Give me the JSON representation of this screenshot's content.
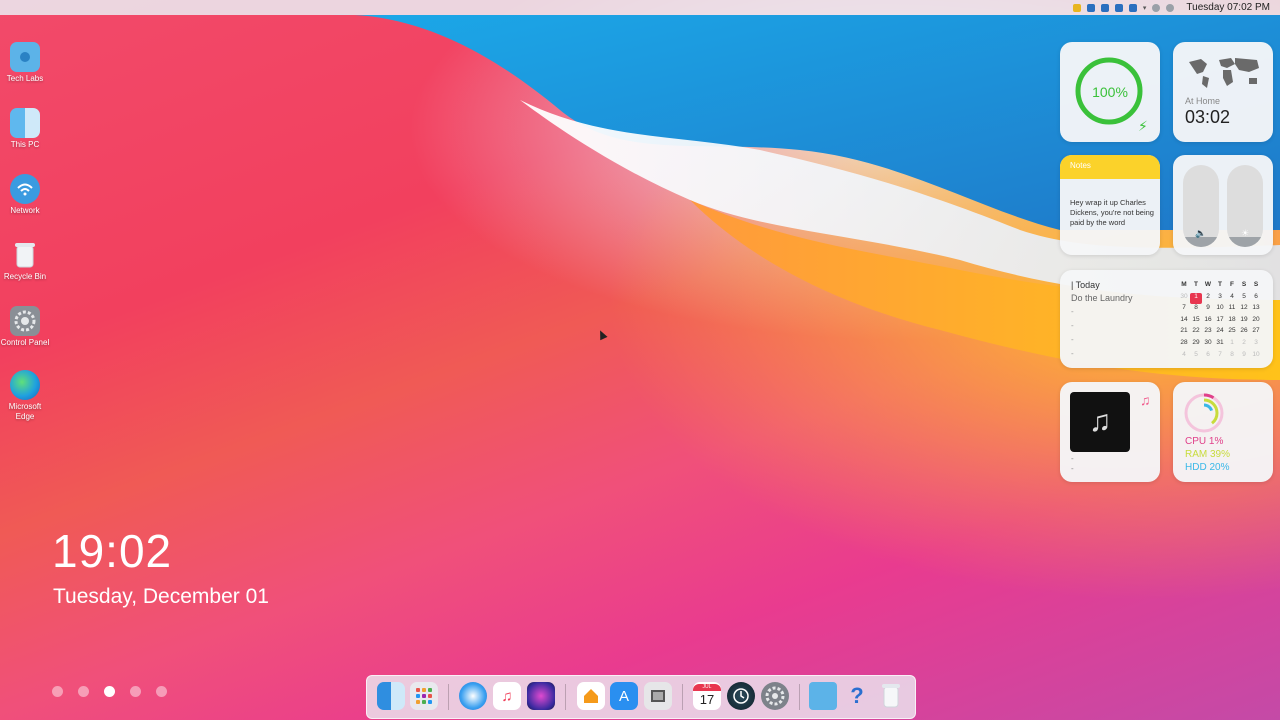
{
  "menubar": {
    "apple_glyph": "",
    "tray_icons": [
      "folder-icon",
      "shield-icon",
      "shield-icon",
      "network-icon",
      "bluetooth-icon",
      "chevron-down-icon",
      "globe-icon",
      "speaker-icon"
    ],
    "datetime": "Tuesday 07:02 PM"
  },
  "desktop_icons": [
    {
      "label": "Tech Labs",
      "icon": "folder-icon"
    },
    {
      "label": "This PC",
      "icon": "finder-icon"
    },
    {
      "label": "Network",
      "icon": "wifi-icon"
    },
    {
      "label": "Recycle Bin",
      "icon": "trash-icon"
    },
    {
      "label": "Control Panel",
      "icon": "gear-icon"
    },
    {
      "label": "Microsoft Edge",
      "icon": "edge-icon"
    }
  ],
  "lock": {
    "time": "19:02",
    "date": "Tuesday, December 01"
  },
  "page_dots": {
    "count": 5,
    "active_index": 2
  },
  "widgets": {
    "battery": {
      "percent_label": "100%",
      "level": 1.0,
      "color": "#3ac13a"
    },
    "world_clock": {
      "label": "At Home",
      "time": "03:02"
    },
    "notes": {
      "title": "Notes",
      "text": "Hey wrap it up Charles Dickens, you're not being paid by the word"
    },
    "sliders": {
      "volume_level": 0.12,
      "brightness_level": 0.12
    },
    "calendar": {
      "heading": "| Today",
      "task": "Do the Laundry",
      "dashes": [
        "-",
        "-",
        "-",
        "-"
      ],
      "weekdays": [
        "M",
        "T",
        "W",
        "T",
        "F",
        "S",
        "S"
      ],
      "rows": [
        [
          "30",
          "1",
          "2",
          "3",
          "4",
          "5",
          "6"
        ],
        [
          "7",
          "8",
          "9",
          "10",
          "11",
          "12",
          "13"
        ],
        [
          "14",
          "15",
          "16",
          "17",
          "18",
          "19",
          "20"
        ],
        [
          "21",
          "22",
          "23",
          "24",
          "25",
          "26",
          "27"
        ],
        [
          "28",
          "29",
          "30",
          "31",
          "1",
          "2",
          "3"
        ],
        [
          "4",
          "5",
          "6",
          "7",
          "8",
          "9",
          "10"
        ]
      ],
      "selected": "1"
    },
    "music": {
      "dashes": [
        "-",
        "-"
      ],
      "icon": "music-note-icon"
    },
    "resources": {
      "cpu": "CPU 1%",
      "ram": "RAM 39%",
      "hdd": "HDD 20%",
      "cpu_color": "#e0408a",
      "ram_color": "#c8dc3c",
      "hdd_color": "#3ab8e8"
    }
  },
  "dock": {
    "apps": [
      "finder-icon",
      "launchpad-icon",
      "safari-icon",
      "music-icon",
      "siri-icon",
      "home-icon",
      "app-store-icon",
      "preview-icon",
      "calendar-icon",
      "time-machine-icon",
      "system-preferences-icon",
      "folder-icon",
      "help-icon",
      "trash-icon"
    ],
    "calendar_month": "JUL",
    "calendar_day": "17",
    "help_glyph": "?"
  }
}
